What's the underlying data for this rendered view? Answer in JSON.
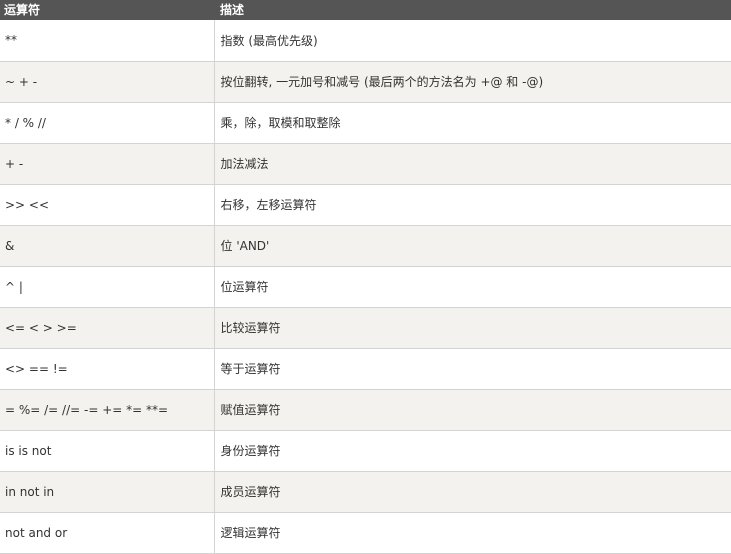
{
  "table": {
    "headers": [
      "运算符",
      "描述"
    ],
    "rows": [
      {
        "operator": "**",
        "description": "指数 (最高优先级)"
      },
      {
        "operator": "~ + -",
        "description": "按位翻转, 一元加号和减号 (最后两个的方法名为 +@ 和 -@)"
      },
      {
        "operator": "* / % //",
        "description": "乘，除，取模和取整除"
      },
      {
        "operator": "+ -",
        "description": "加法减法"
      },
      {
        "operator": ">> <<",
        "description": "右移，左移运算符"
      },
      {
        "operator": "&",
        "description": "位 'AND'"
      },
      {
        "operator": "^ |",
        "description": "位运算符"
      },
      {
        "operator": "<= < > >=",
        "description": "比较运算符"
      },
      {
        "operator": "<> == !=",
        "description": "等于运算符"
      },
      {
        "operator": "= %= /= //= -= += *= **=",
        "description": "赋值运算符"
      },
      {
        "operator": "is is not",
        "description": "身份运算符"
      },
      {
        "operator": "in not in",
        "description": "成员运算符"
      },
      {
        "operator": "not and or",
        "description": "逻辑运算符"
      }
    ]
  },
  "colors": {
    "header_bg": "#555555",
    "header_text": "#ffffff",
    "row_alt_bg": "#f3f2ee",
    "border": "#d4d4d4"
  }
}
